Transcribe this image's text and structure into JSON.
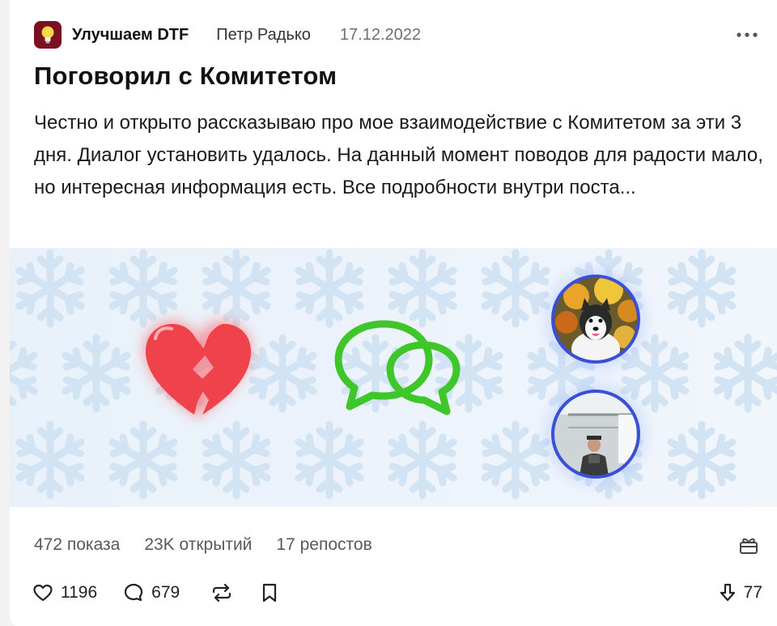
{
  "post": {
    "subsite": "Улучшаем DTF",
    "author": "Петр Радько",
    "date": "17.12.2022",
    "title": "Поговорил с Комитетом",
    "excerpt": "Честно и открыто рассказываю про мое взаимодействие с Комитетом за эти 3 дня. Диалог установить удалось. На данный момент поводов для радости мало, но интересная информация есть. Все подробности внутри поста..."
  },
  "stats": {
    "views": "472 показа",
    "opens": "23K открытий",
    "reposts": "17 репостов"
  },
  "actions": {
    "likes": "1196",
    "comments": "679",
    "rating": "77"
  },
  "icons": {
    "subsite_avatar": "lightbulb-icon",
    "more": "ellipsis-icon",
    "gift": "gift-icon",
    "like": "heart-icon",
    "comment": "comment-bubble-icon",
    "repost": "repost-arrows-icon",
    "bookmark": "bookmark-icon",
    "rating": "arrow-down-icon"
  },
  "colors": {
    "subsite_avatar_bg": "#7a1020",
    "heart": "#f0424a",
    "chat_green": "#3ec62b",
    "avatar_ring": "#3a4fd6",
    "snowflake": "#c7ddf2",
    "cover_bg": "#e7f1fb"
  }
}
